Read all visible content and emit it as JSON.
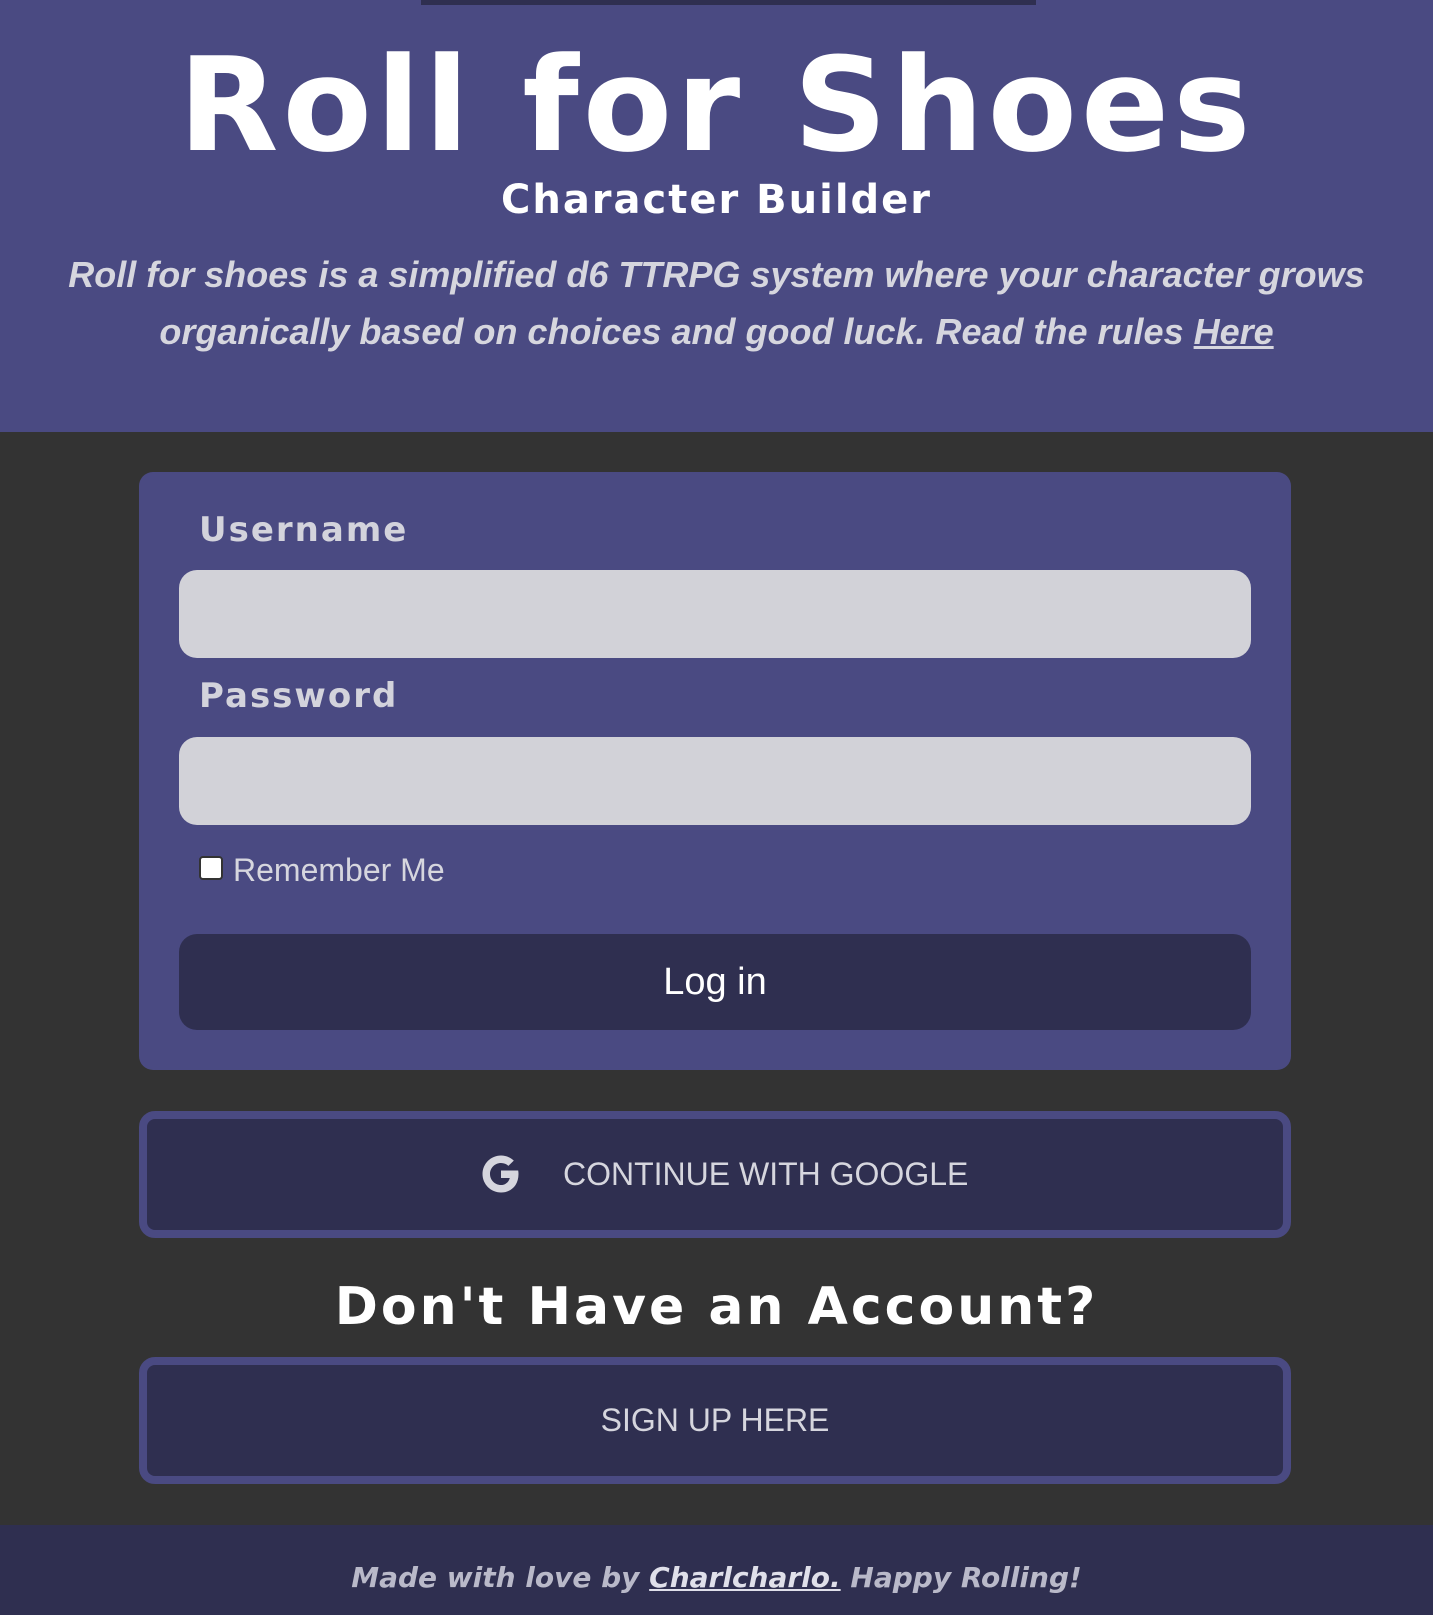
{
  "header": {
    "title": "Roll for Shoes",
    "subtitle": "Character Builder",
    "intro_text": "Roll for shoes is a simplified d6 TTRPG system where your character grows organically based on choices and good luck. Read the rules ",
    "rules_link_text": "Here"
  },
  "login_form": {
    "username_label": "Username",
    "username_value": "",
    "password_label": "Password",
    "password_value": "",
    "remember_label": "Remember Me",
    "remember_checked": false,
    "login_button_label": "Log in"
  },
  "google_button": {
    "icon": "google-g-icon",
    "label": "CONTINUE WITH GOOGLE"
  },
  "signup": {
    "heading": "Don't Have an Account?",
    "button_label": "SIGN UP HERE"
  },
  "footer": {
    "prefix": "Made with love by ",
    "author_link": "Charlcharlo.",
    "suffix": " Happy Rolling!"
  },
  "colors": {
    "brand_purple": "#4a4a82",
    "dark_purple": "#2f2f50",
    "background": "#333333",
    "input_bg": "#d2d2d8",
    "text_light": "#d6d6de"
  }
}
